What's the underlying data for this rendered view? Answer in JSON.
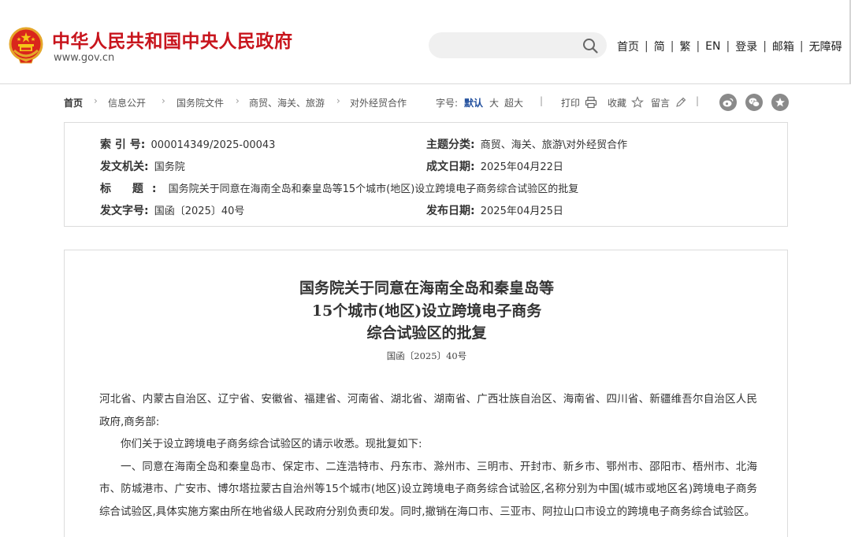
{
  "header": {
    "site_title": "中华人民共和国中央人民政府",
    "site_url": "www.gov.cn",
    "search_placeholder": "",
    "links": [
      "首页",
      "简",
      "繁",
      "EN",
      "登录",
      "邮箱",
      "无障碍"
    ],
    "link_separator": "|"
  },
  "breadcrumb": {
    "items": [
      "首页",
      "信息公开",
      "国务院文件",
      "商贸、海关、旅游",
      "对外经贸合作"
    ]
  },
  "toolbar": {
    "font_size_label": "字号:",
    "font_sizes": [
      "默认",
      "大",
      "超大"
    ],
    "print_label": "打印",
    "favorite_label": "收藏",
    "comment_label": "留言",
    "separator": "|"
  },
  "info": {
    "index_no_label": "索 引 号:",
    "index_no": "000014349/2025-00043",
    "category_label": "主题分类:",
    "category": "商贸、海关、旅游\\对外经贸合作",
    "issuer_label": "发文机关:",
    "issuer": "国务院",
    "written_date_label": "成文日期:",
    "written_date": "2025年04月22日",
    "title_label": "标 题:",
    "title": "国务院关于同意在海南全岛和秦皇岛等15个城市(地区)设立跨境电子商务综合试验区的批复",
    "doc_no_label": "发文字号:",
    "doc_no": "国函〔2025〕40号",
    "publish_date_label": "发布日期:",
    "publish_date": "2025年04月25日"
  },
  "article": {
    "title_lines": [
      "国务院关于同意在海南全岛和秦皇岛等",
      "15个城市(地区)设立跨境电子商务",
      "综合试验区的批复"
    ],
    "doc_no": "国函〔2025〕40号",
    "paragraphs": [
      "河北省、内蒙古自治区、辽宁省、安徽省、福建省、河南省、湖北省、湖南省、广西壮族自治区、海南省、四川省、新疆维吾尔自治区人民政府,商务部:",
      "你们关于设立跨境电子商务综合试验区的请示收悉。现批复如下:",
      "一、同意在海南全岛和秦皇岛市、保定市、二连浩特市、丹东市、滁州市、三明市、开封市、新乡市、鄂州市、邵阳市、梧州市、北海市、防城港市、广安市、博尔塔拉蒙古自治州等15个城市(地区)设立跨境电子商务综合试验区,名称分别为中国(城市或地区名)跨境电子商务综合试验区,具体实施方案由所在地省级人民政府分别负责印发。同时,撤销在海口市、三亚市、阿拉山口市设立的跨境电子商务综合试验区。"
    ]
  },
  "colors": {
    "brand_red": "#c8151d",
    "active_blue": "#1f4d9c",
    "border_gray": "#dcdcdc"
  },
  "icons": [
    "national-emblem-icon",
    "search-icon",
    "print-icon",
    "star-icon",
    "pencil-icon",
    "weibo-icon",
    "wechat-icon",
    "favorite-star-icon"
  ]
}
